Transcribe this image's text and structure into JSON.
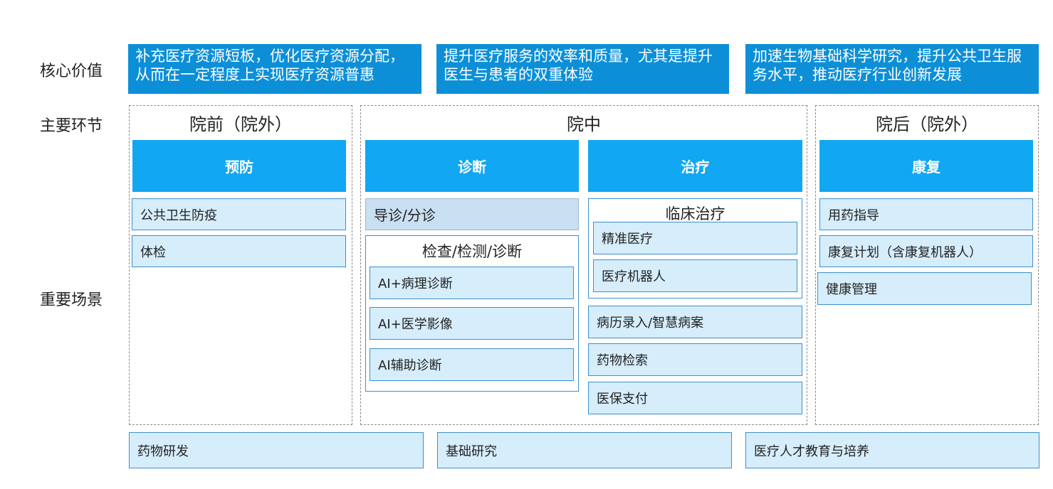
{
  "row_labels": {
    "core_value": "核心价值",
    "main_links": "主要环节",
    "key_scenarios": "重要场景"
  },
  "core_values": [
    "补充医疗资源短板，优化医疗资源分配，从而在一定程度上实现医疗资源普惠",
    "提升医疗服务的效率和质量，尤其是提升医生与患者的双重体验",
    "加速生物基础科学研究，提升公共卫生服务水平，推动医疗行业创新发展"
  ],
  "sections": {
    "pre": {
      "title": "院前（院外）"
    },
    "mid": {
      "title": "院中"
    },
    "post": {
      "title": "院后（院外）"
    }
  },
  "phases": {
    "prevention": "预防",
    "diagnosis": "诊断",
    "treatment": "治疗",
    "rehab": "康复"
  },
  "prevention_items": [
    "公共卫生防疫",
    "体检"
  ],
  "diagnosis": {
    "guide": "导诊/分诊",
    "exam_title": "检查/检测/诊断",
    "exam_items": [
      "AI+病理诊断",
      "AI+医学影像",
      "AI辅助诊断"
    ]
  },
  "treatment": {
    "clinical_title": "临床治疗",
    "clinical_items": [
      "精准医疗",
      "医疗机器人"
    ],
    "other_items": [
      "病历录入/智慧病案",
      "药物检索",
      "医保支付"
    ]
  },
  "rehab_items": [
    "用药指导",
    "康复计划（含康复机器人）",
    "健康管理"
  ],
  "bottom_items": [
    "药物研发",
    "基础研究",
    "医疗人才教育与培养"
  ],
  "colors": {
    "value_bg": "#0d8fd8",
    "phase_bg": "#11a7f2",
    "item_bg": "#d6edfb",
    "item_border": "#3d8fd0"
  }
}
